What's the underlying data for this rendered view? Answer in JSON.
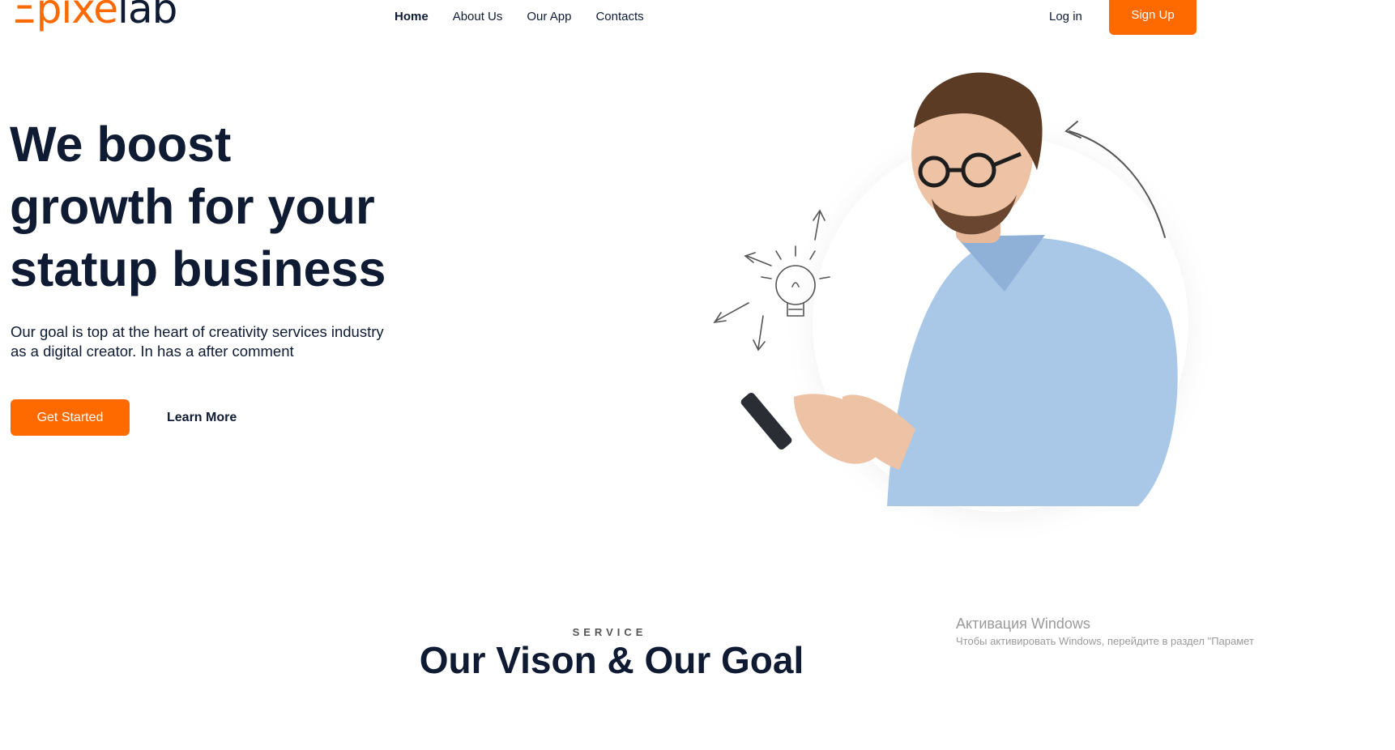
{
  "brand": {
    "logo_prefix": "Ξ",
    "logo_mid": "pixe",
    "logo_suffix": "lab",
    "accent": "#ff6a00",
    "dark": "#0f1b33"
  },
  "nav": {
    "items": [
      "Home",
      "About Us",
      "Our App",
      "Contacts"
    ],
    "active": "Home"
  },
  "auth": {
    "login_label": "Log in",
    "signup_label": "Sign Up"
  },
  "hero": {
    "headline_line1": "We boost",
    "headline_line2": "growth for your",
    "headline_line3": "statup business",
    "subtitle_line1": "Our goal is top at the heart of creativity services industry",
    "subtitle_line2": "as a digital creator. In has a after comment",
    "primary_cta": "Get Started",
    "secondary_cta": "Learn More",
    "illustration_icons": [
      "lightbulb-icon",
      "arrow-icon",
      "smartphone-icon"
    ]
  },
  "service": {
    "eyebrow": "SERVICE",
    "title": "Our Vison & Our Goal"
  },
  "watermark": {
    "title": "Активация Windows",
    "subtitle": "Чтобы активировать Windows, перейдите в раздел \"Парамет"
  }
}
